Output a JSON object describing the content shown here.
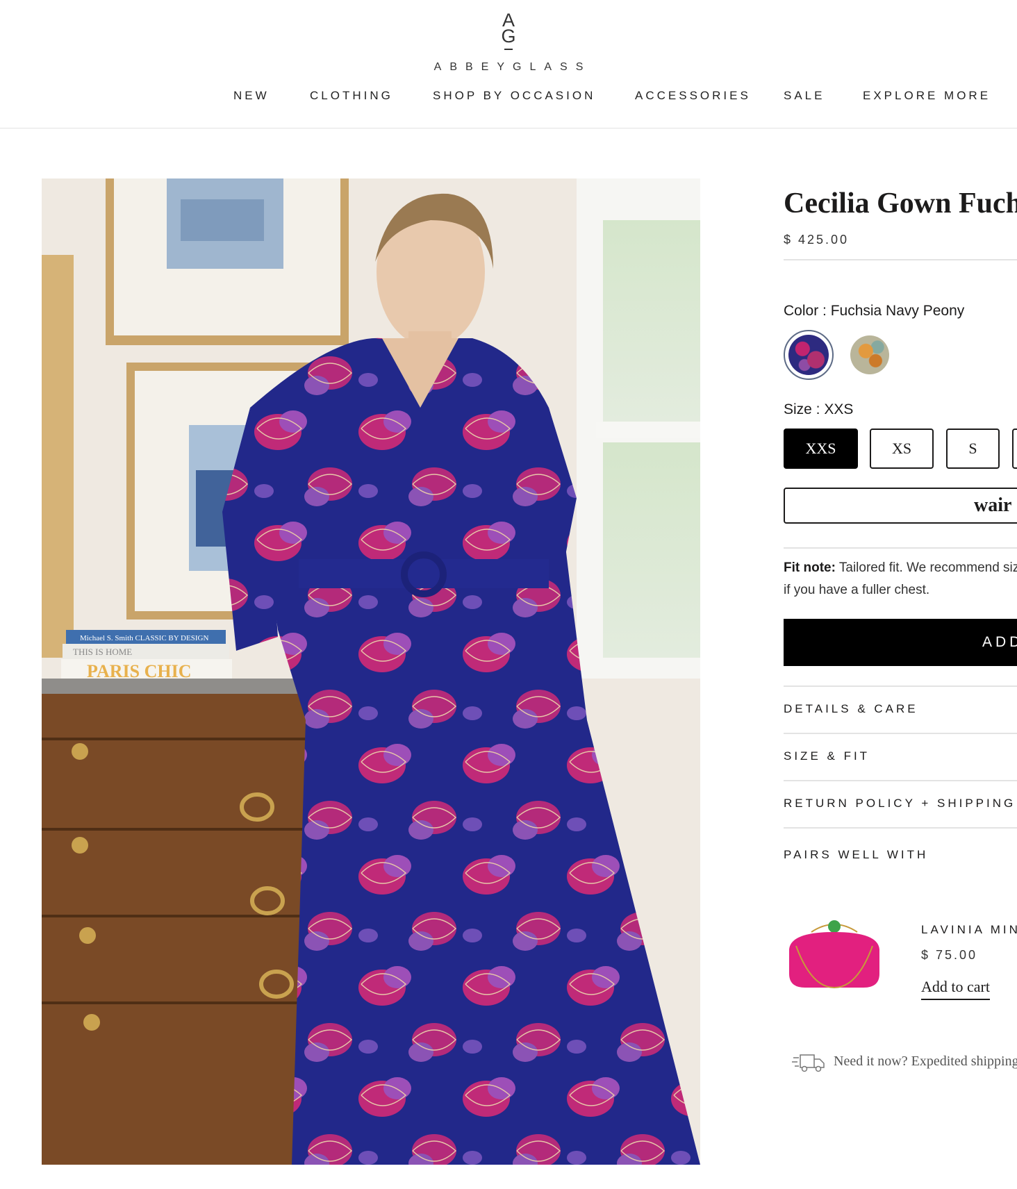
{
  "brand": {
    "monogram_top": "A",
    "monogram_bottom": "G",
    "wordmark": "ABBEYGLASS"
  },
  "nav": {
    "items": [
      "NEW",
      "CLOTHING",
      "SHOP BY OCCASION",
      "ACCESSORIES",
      "SALE",
      "EXPLORE MORE"
    ]
  },
  "product_image": {
    "books": {
      "book1": "Michael S. Smith  CLASSIC BY DESIGN",
      "book2": "THIS IS HOME",
      "book3": "PARIS CHIC"
    },
    "colors": {
      "dress": "#22288a",
      "floral": "#c02a78",
      "wall": "#efe9e1",
      "wood": "#7a4a26"
    }
  },
  "product": {
    "title": "Cecilia Gown Fuchsia Navy Peony",
    "price": "$ 425.00",
    "color_label": "Color : ",
    "color_value": "Fuchsia Navy Peony",
    "size_label": "Size : ",
    "size_value": "XXS",
    "sizes": [
      "XXS",
      "XS",
      "S"
    ],
    "wair_label": "wair",
    "fit_note_label": "Fit note:",
    "fit_note_text": " Tailored fit. We recommend sizing up if you have a fuller chest.",
    "add_to_cart": "ADD TO CART",
    "accordions": [
      "DETAILS & CARE",
      "SIZE & FIT",
      "RETURN POLICY + SHIPPING POLICY"
    ]
  },
  "pairs_well": {
    "heading": "PAIRS WELL WITH",
    "item_name": "LAVINIA MINI CLUTCH",
    "item_price": "$ 75.00",
    "item_cta": "Add to cart"
  },
  "shipping_note": "Need it now? Expedited shipping available"
}
